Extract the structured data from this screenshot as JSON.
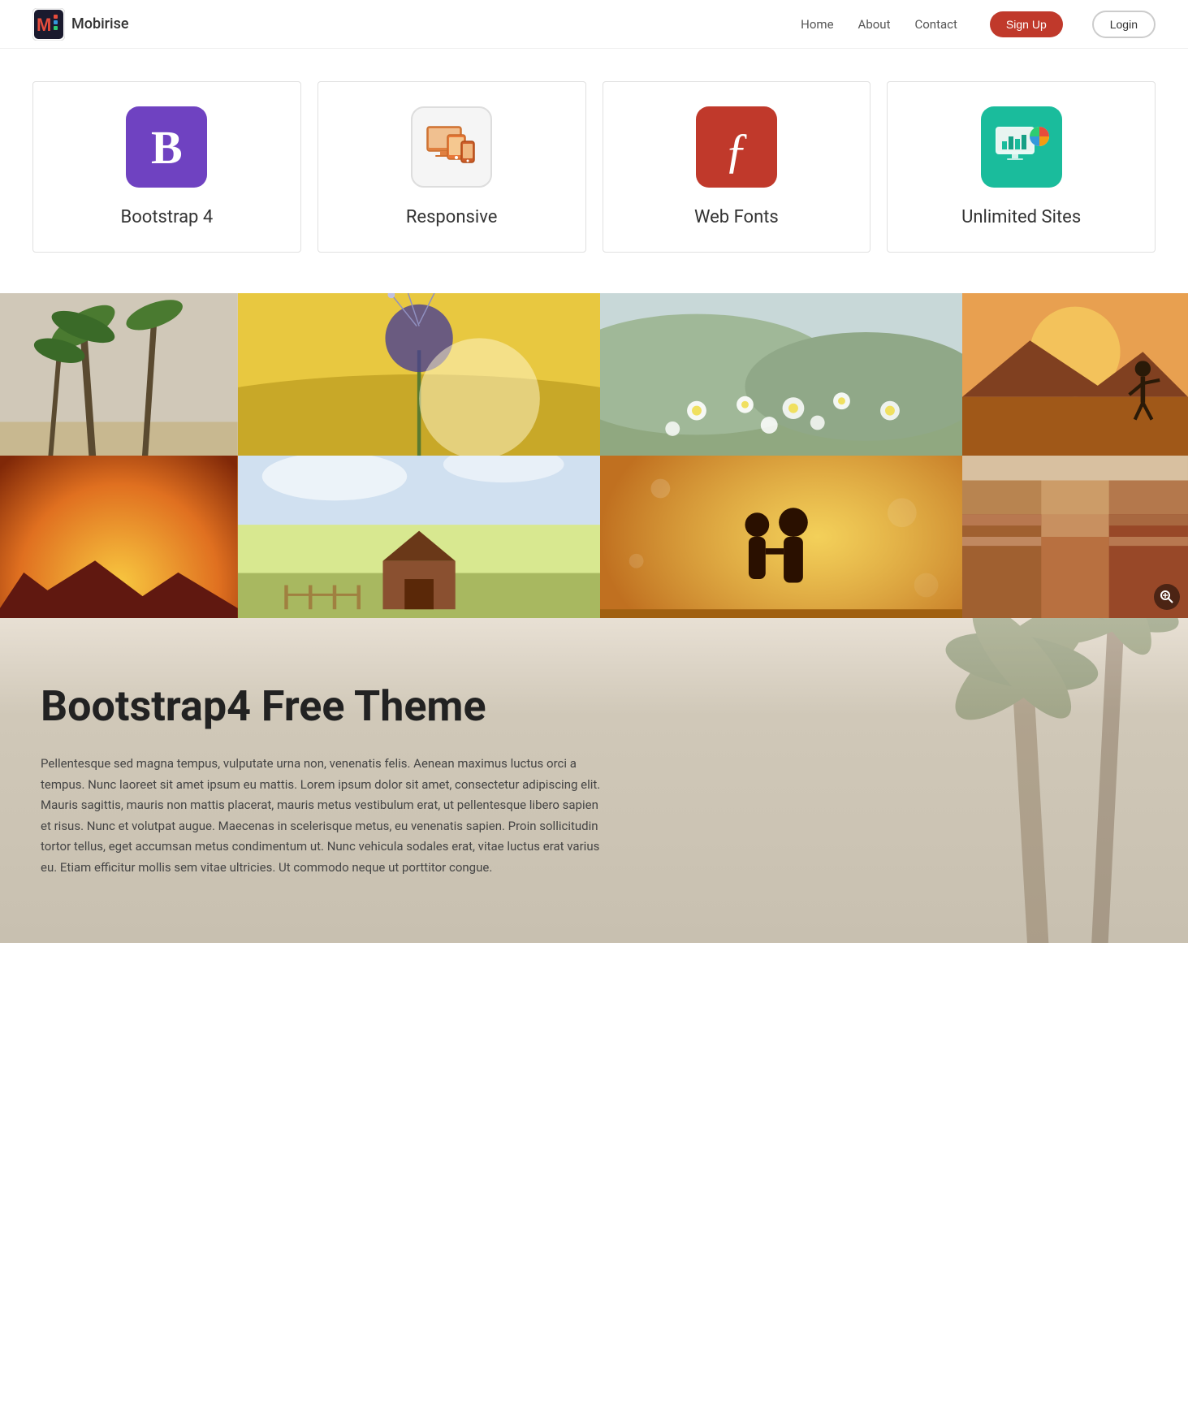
{
  "brand": {
    "name": "Mobirise"
  },
  "nav": {
    "home": "Home",
    "about": "About",
    "contact": "Contact",
    "signup": "Sign Up",
    "login": "Login"
  },
  "features": [
    {
      "id": "bootstrap",
      "title": "Bootstrap 4",
      "icon_label": "B",
      "icon_type": "bootstrap"
    },
    {
      "id": "responsive",
      "title": "Responsive",
      "icon_label": "",
      "icon_type": "responsive"
    },
    {
      "id": "webfonts",
      "title": "Web Fonts",
      "icon_label": "ƒ",
      "icon_type": "webfonts"
    },
    {
      "id": "unlimited",
      "title": "Unlimited Sites",
      "icon_label": "",
      "icon_type": "unlimited"
    }
  ],
  "content": {
    "title": "Bootstrap4 Free Theme",
    "body": "Pellentesque sed magna tempus, vulputate urna non, venenatis felis. Aenean maximus luctus orci a tempus. Nunc laoreet sit amet ipsum eu mattis. Lorem ipsum dolor sit amet, consectetur adipiscing elit. Mauris sagittis, mauris non mattis placerat, mauris metus vestibulum erat, ut pellentesque libero sapien et risus. Nunc et volutpat augue. Maecenas in scelerisque metus, eu venenatis sapien. Proin sollicitudin tortor tellus, eget accumsan metus condimentum ut. Nunc vehicula sodales erat, vitae luctus erat varius eu. Etiam efficitur mollis sem vitae ultricies. Ut commodo neque ut porttitor congue."
  }
}
